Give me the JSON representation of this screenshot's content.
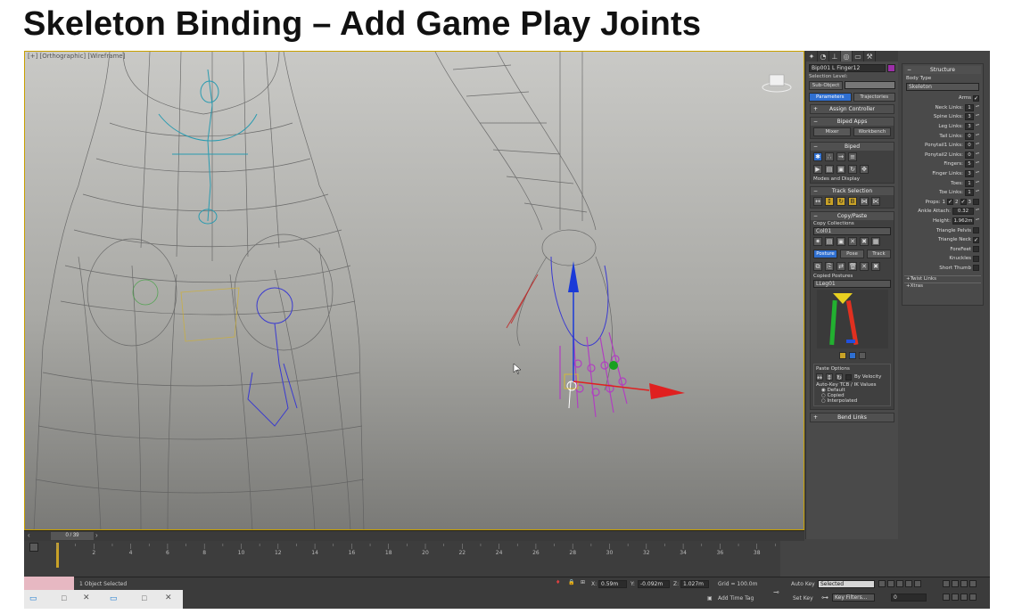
{
  "slide": {
    "title": "Skeleton Binding – Add Game Play Joints"
  },
  "viewport": {
    "label": "[+] [Orthographic] [Wireframe]"
  },
  "command_panel": {
    "tabs": [
      "create",
      "modify",
      "hierarchy",
      "motion",
      "display",
      "utilities"
    ],
    "object_name": "Bip001 L Finger12",
    "selection_level_label": "Selection Level:",
    "subobject_label": "Sub-Object",
    "parameters_tab": "Parameters",
    "trajectories_tab": "Trajectories",
    "assign_controller": "Assign Controller",
    "biped_apps": "Biped Apps",
    "mixer": "Mixer",
    "workbench": "Workbench",
    "biped": "Biped",
    "modes_display": "Modes and Display",
    "track_selection": "Track Selection",
    "copy_paste": "Copy/Paste",
    "copy_collections": "Copy Collections",
    "collection_value": "Col01",
    "posture_tab": "Posture",
    "pose_tab": "Pose",
    "track_tab": "Track",
    "copied_postures": "Copied Postures",
    "posture_value": "LLeg01",
    "paste_options": "Paste Options",
    "by_velocity": "By Velocity",
    "autokey_label": "Auto-Key TCB / IK Values",
    "opt_default": "Default",
    "opt_copied": "Copied",
    "opt_interpolated": "Interpolated",
    "bend_links": "Bend Links"
  },
  "structure": {
    "header": "Structure",
    "body_type_label": "Body Type",
    "body_type": "Skeleton",
    "arms": "Arms",
    "neck_links": "Neck Links:",
    "neck_links_v": "1",
    "spine_links": "Spine Links:",
    "spine_links_v": "3",
    "leg_links": "Leg Links:",
    "leg_links_v": "3",
    "tail_links": "Tail Links:",
    "tail_links_v": "0",
    "ponytail1": "Ponytail1 Links:",
    "ponytail1_v": "0",
    "ponytail2": "Ponytail2 Links:",
    "ponytail2_v": "0",
    "fingers": "Fingers:",
    "fingers_v": "5",
    "finger_links": "Finger Links:",
    "finger_links_v": "3",
    "toes": "Toes:",
    "toes_v": "1",
    "toe_links": "Toe Links:",
    "toe_links_v": "1",
    "props": "Props:",
    "props_1": "1",
    "props_2": "2",
    "props_3": "3",
    "ankle_attach": "Ankle Attach:",
    "ankle_attach_v": "0.32",
    "height": "Height:",
    "height_v": "1.962m",
    "triangle_pelvis": "Triangle Pelvis",
    "triangle_neck": "Triangle Neck",
    "forefeet": "ForeFeet",
    "knuckles": "Knuckles",
    "short_thumb": "Short Thumb",
    "twist_links": "Twist Links",
    "xtras": "Xtras"
  },
  "timeline": {
    "frame_counter": "0 / 39",
    "ticks": [
      "2",
      "4",
      "6",
      "8",
      "10",
      "12",
      "14",
      "16",
      "18",
      "20",
      "22",
      "24",
      "26",
      "28",
      "30",
      "32",
      "34",
      "36",
      "38"
    ]
  },
  "status": {
    "selected": "1 Object Selected",
    "x_label": "X:",
    "x": "0.59m",
    "y_label": "Y:",
    "y": "-0.092m",
    "z_label": "Z:",
    "z": "1.027m",
    "grid": "Grid = 100.0m",
    "add_time_tag": "Add Time Tag",
    "auto_key": "Auto Key",
    "set_key": "Set Key",
    "selected_dropdown": "Selected",
    "key_filters": "Key Filters...",
    "frame_field": "0"
  },
  "colors": {
    "accent_blue": "#2f6fd0",
    "gizmo_red": "#e02020",
    "gizmo_green": "#18a020",
    "gizmo_blue": "#1a3ad8",
    "wire": "#5e5e5e",
    "biped_blue": "#3a3ad0",
    "biped_magenta": "#b040c0"
  }
}
